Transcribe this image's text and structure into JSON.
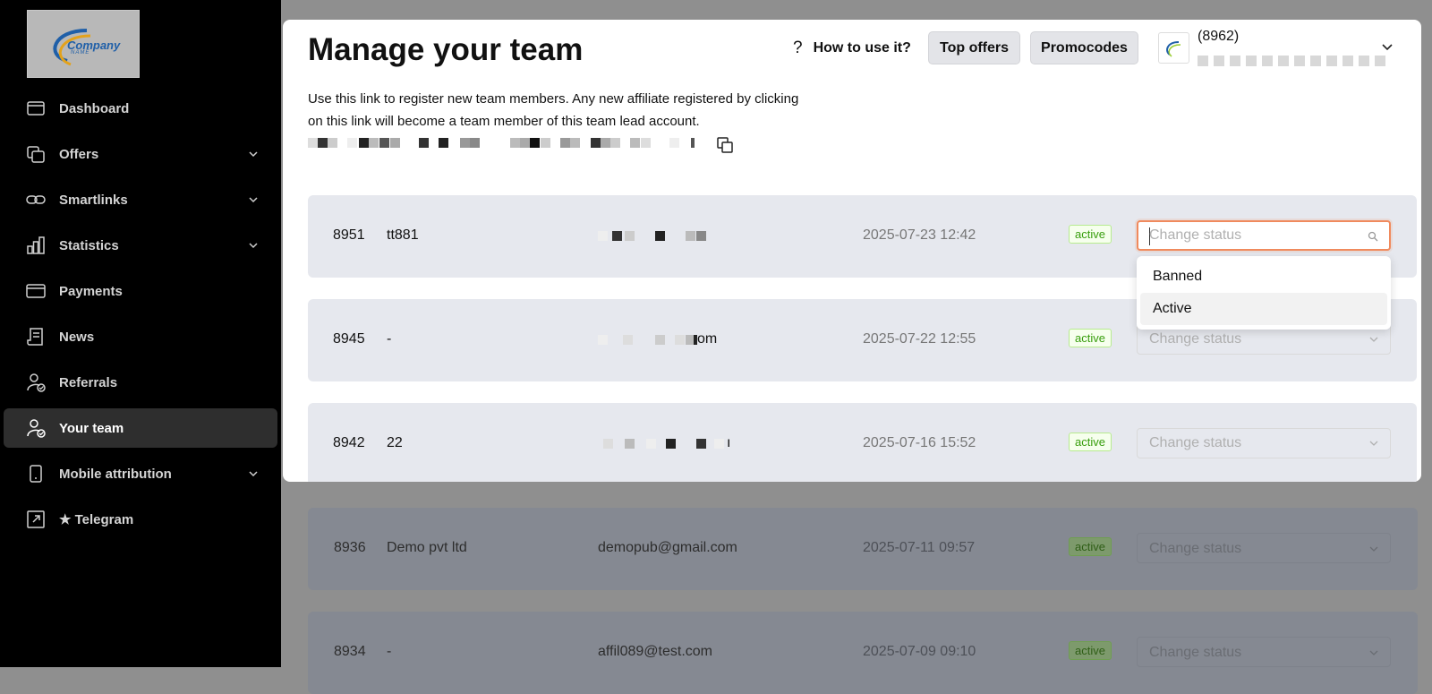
{
  "sidebar": {
    "logo_line1": "Company",
    "logo_line2": "NAME",
    "items": [
      {
        "label": "Dashboard",
        "icon": "dashboard-icon"
      },
      {
        "label": "Offers",
        "icon": "offers-icon",
        "expandable": true
      },
      {
        "label": "Smartlinks",
        "icon": "link-icon",
        "expandable": true
      },
      {
        "label": "Statistics",
        "icon": "bar-chart-icon",
        "expandable": true
      },
      {
        "label": "Payments",
        "icon": "card-icon"
      },
      {
        "label": "News",
        "icon": "news-icon"
      },
      {
        "label": "Referrals",
        "icon": "referrals-icon"
      },
      {
        "label": "Your team",
        "icon": "team-icon",
        "active": true
      },
      {
        "label": "Mobile attribution",
        "icon": "mobile-icon",
        "expandable": true
      },
      {
        "label": "★ Telegram",
        "icon": "external-link-icon"
      }
    ]
  },
  "header": {
    "title": "Manage your team",
    "help_label": "How to use it?",
    "top_offers_label": "Top offers",
    "promocodes_label": "Promocodes",
    "user_id": "(8962)"
  },
  "description": "Use this link to register new team members. Any new affiliate registered by clicking on this link will become a team member of this team lead account.",
  "members": [
    {
      "id": "8951",
      "name": "tt881",
      "email": "",
      "date": "2025-07-23 12:42",
      "status": "active"
    },
    {
      "id": "8945",
      "name": "-",
      "email_tail": "om",
      "date": "2025-07-22 12:55",
      "status": "active"
    },
    {
      "id": "8942",
      "name": "22",
      "email_tail": "ı",
      "date": "2025-07-16 15:52",
      "status": "active"
    },
    {
      "id": "8936",
      "name": "Demo pvt ltd",
      "email": "demopub@gmail.com",
      "date": "2025-07-11 09:57",
      "status": "active"
    },
    {
      "id": "8934",
      "name": "-",
      "email": "affil089@test.com",
      "date": "2025-07-09 09:10",
      "status": "active"
    }
  ],
  "status_select": {
    "placeholder": "Change status",
    "options": [
      "Banned",
      "Active"
    ]
  },
  "colors": {
    "sidebar_bg": "#000000",
    "accent_focus": "#f08a5d",
    "badge_green": "#389e0d"
  }
}
